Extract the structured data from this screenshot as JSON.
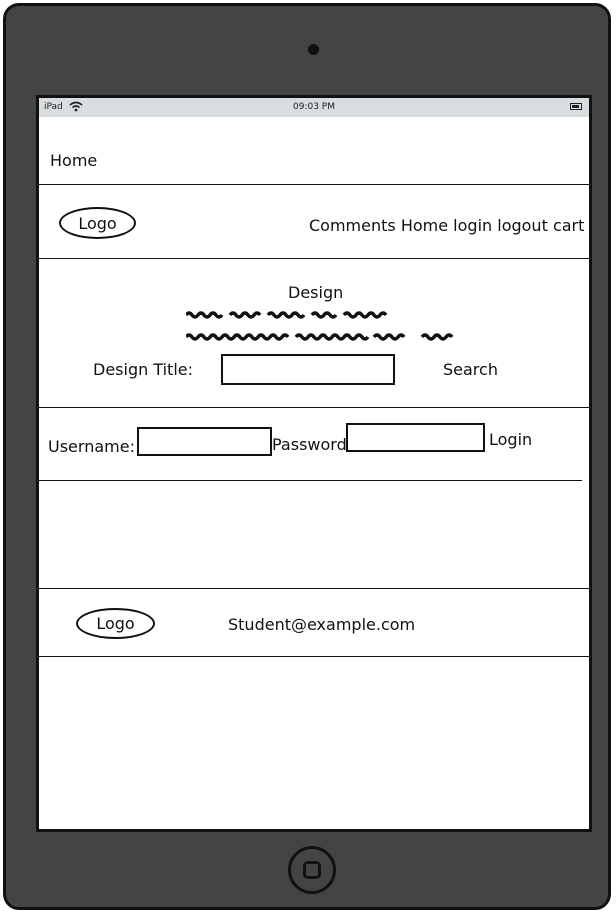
{
  "status_bar": {
    "carrier": "iPad",
    "time": "09:03 PM",
    "icons": [
      "wifi-icon",
      "battery-icon"
    ]
  },
  "page_header": {
    "title": "Home"
  },
  "nav": {
    "logo_label": "Logo",
    "links": [
      "Comments",
      "Home",
      "login",
      "logout",
      "cart"
    ]
  },
  "design_section": {
    "heading": "Design",
    "design_title_label": "Design Title:",
    "design_title_value": "",
    "search_label": "Search"
  },
  "login_form": {
    "username_label": "Username:",
    "username_value": "",
    "password_label": "Password",
    "password_value": "",
    "login_label": "Login"
  },
  "footer": {
    "logo_label": "Logo",
    "email": "Student@example.com"
  },
  "colors": {
    "device_frame": "#444444",
    "status_bar": "#d8dde0",
    "ink": "#111111"
  }
}
